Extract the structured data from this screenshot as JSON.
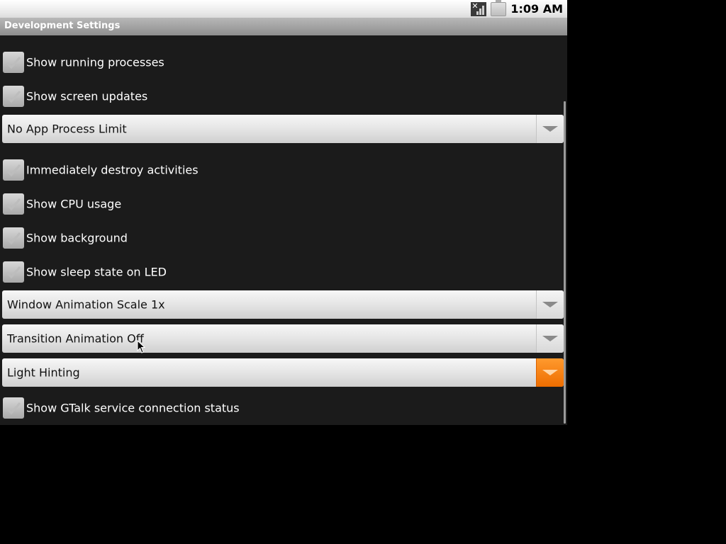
{
  "status": {
    "time": "1:09 AM"
  },
  "titlebar": {
    "title": "Development Settings"
  },
  "list": {
    "show_running_processes": {
      "label": "Show running processes",
      "checked": true
    },
    "show_screen_updates": {
      "label": "Show screen updates",
      "checked": true
    },
    "app_process_limit": {
      "value": "No App Process Limit"
    },
    "immediately_destroy": {
      "label": "Immediately destroy activities",
      "checked": true
    },
    "show_cpu_usage": {
      "label": "Show CPU usage",
      "checked": true
    },
    "show_background": {
      "label": "Show background",
      "checked": true
    },
    "show_sleep_led": {
      "label": "Show sleep state on LED",
      "checked": true
    },
    "window_animation": {
      "value": "Window Animation Scale 1x"
    },
    "transition_animation": {
      "value": "Transition Animation Off"
    },
    "font_hinting": {
      "value": "Light Hinting"
    },
    "show_gtalk_status": {
      "label": "Show GTalk service connection status",
      "checked": true
    }
  },
  "colors": {
    "accent": "#f07c10",
    "background": "#1b1b1b"
  },
  "icons": [
    "signal-icon",
    "battery-icon",
    "checkmark-icon",
    "dropdown-arrow-icon",
    "mouse-cursor-icon"
  ]
}
